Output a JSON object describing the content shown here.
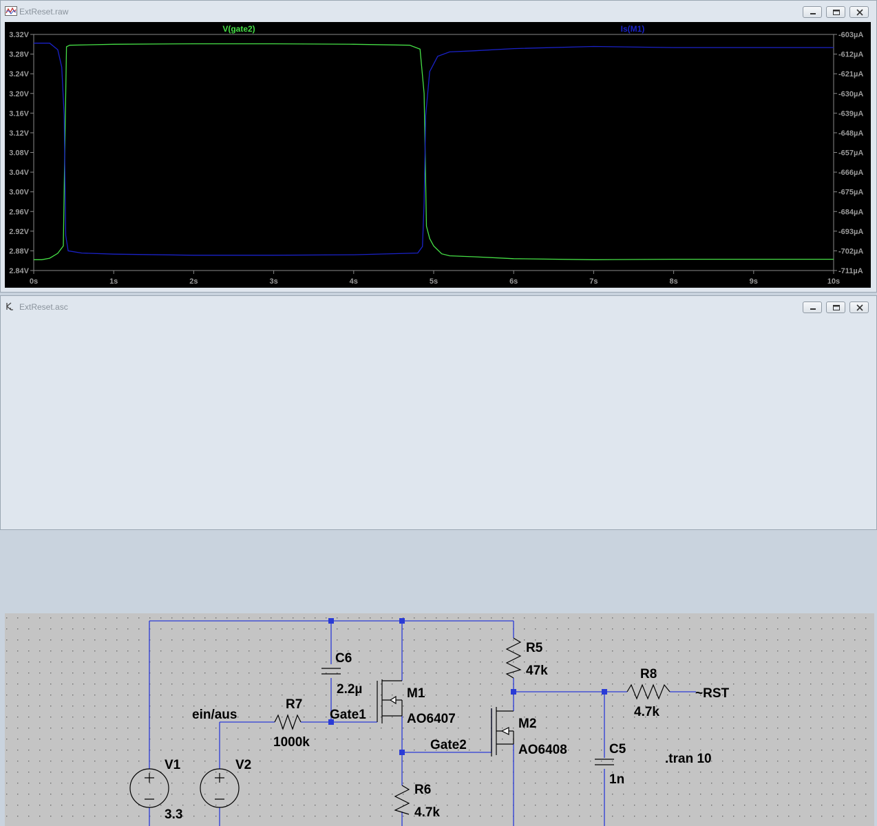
{
  "waveform_window": {
    "title": "ExtReset.raw",
    "buttons": {
      "minimize": "minimize",
      "restore": "restore",
      "close": "close"
    }
  },
  "schematic_window": {
    "title": "ExtReset.asc"
  },
  "chart_data": {
    "type": "line",
    "title": "",
    "xlabel": "",
    "x_ticks": [
      "0s",
      "1s",
      "2s",
      "3s",
      "4s",
      "5s",
      "6s",
      "7s",
      "8s",
      "9s",
      "10s"
    ],
    "xlim": [
      0,
      10
    ],
    "y_left_ticks": [
      "3.32V",
      "3.28V",
      "3.24V",
      "3.20V",
      "3.16V",
      "3.12V",
      "3.08V",
      "3.04V",
      "3.00V",
      "2.96V",
      "2.92V",
      "2.88V",
      "2.84V"
    ],
    "ylim_left": [
      2.84,
      3.32
    ],
    "y_right_ticks": [
      "-603µA",
      "-612µA",
      "-621µA",
      "-630µA",
      "-639µA",
      "-648µA",
      "-657µA",
      "-666µA",
      "-675µA",
      "-684µA",
      "-693µA",
      "-702µA",
      "-711µA"
    ],
    "ylim_right": [
      -711,
      -603
    ],
    "grid": true,
    "series": [
      {
        "name": "V(gate2)",
        "axis": "left",
        "color": "#46e046",
        "x": [
          0,
          0.1,
          0.2,
          0.3,
          0.37,
          0.39,
          0.41,
          0.45,
          1,
          2,
          3,
          4,
          4.7,
          4.83,
          4.88,
          4.91,
          4.95,
          5.0,
          5.1,
          5.2,
          5.5,
          6,
          7,
          8,
          9,
          10
        ],
        "y": [
          2.862,
          2.862,
          2.865,
          2.875,
          2.89,
          3.1,
          3.295,
          3.298,
          3.3,
          3.301,
          3.301,
          3.3,
          3.298,
          3.29,
          3.2,
          2.93,
          2.905,
          2.89,
          2.874,
          2.87,
          2.868,
          2.864,
          2.862,
          2.863,
          2.863,
          2.863
        ]
      },
      {
        "name": "Is(M1)",
        "axis": "right",
        "color": "#1a22c8",
        "x": [
          0,
          0.2,
          0.3,
          0.35,
          0.38,
          0.4,
          0.43,
          0.6,
          1,
          2,
          3,
          4,
          4.8,
          4.86,
          4.88,
          4.9,
          4.95,
          5.05,
          5.2,
          5.5,
          6,
          7,
          8,
          9,
          10
        ],
        "y": [
          -607,
          -607,
          -610,
          -618,
          -640,
          -695,
          -702,
          -703,
          -703.5,
          -704,
          -704,
          -703.8,
          -703,
          -700,
          -680,
          -640,
          -620,
          -613,
          -611,
          -610.5,
          -609.5,
          -608.5,
          -609,
          -609,
          -609
        ]
      }
    ]
  },
  "circuit": {
    "components": [
      {
        "ref": "V1",
        "value": "3.3"
      },
      {
        "ref": "V2"
      },
      {
        "ref": "R7",
        "value": "1000k"
      },
      {
        "ref": "C6",
        "value": "2.2µ"
      },
      {
        "ref": "M1",
        "value": "AO6407"
      },
      {
        "ref": "R5",
        "value": "47k"
      },
      {
        "ref": "R6",
        "value": "4.7k"
      },
      {
        "ref": "M2",
        "value": "AO6408"
      },
      {
        "ref": "R8",
        "value": "4.7k"
      },
      {
        "ref": "C5",
        "value": "1n"
      }
    ],
    "nets": {
      "input": "ein/aus",
      "gate1": "Gate1",
      "gate2": "Gate2",
      "reset": "~RST"
    },
    "directive": ".tran 10"
  }
}
